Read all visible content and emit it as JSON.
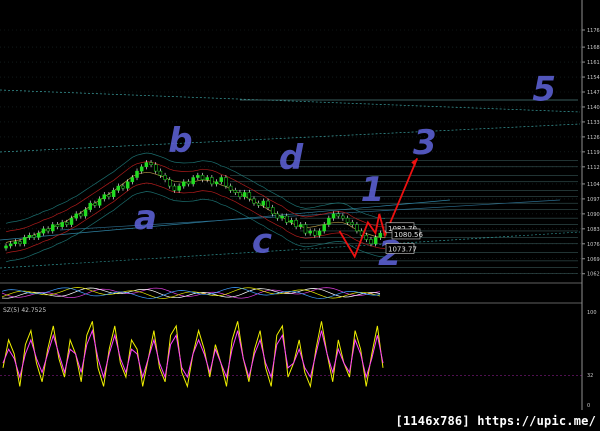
{
  "chart_data": [
    {
      "type": "candlestick",
      "grid": true,
      "ylim": [
        1060,
        1176
      ],
      "price_ticks": [
        "1176",
        "1168",
        "1161",
        "1154",
        "1147",
        "1140",
        "1133",
        "1126",
        "1119",
        "1112",
        "1104",
        "1097",
        "1090",
        "1083",
        "1076",
        "1069",
        "1062"
      ],
      "price_labels": [
        {
          "text": "1082.70",
          "value": 1083.5
        },
        {
          "text": "1080.56",
          "value": 1080.6
        },
        {
          "text": "1073.77",
          "value": 1073.8
        }
      ],
      "close": [
        1075,
        1076,
        1077,
        1076,
        1079,
        1080,
        1079,
        1081,
        1083,
        1082,
        1085,
        1084,
        1086,
        1085,
        1088,
        1090,
        1089,
        1092,
        1095,
        1094,
        1097,
        1099,
        1098,
        1101,
        1103,
        1102,
        1105,
        1107,
        1110,
        1112,
        1114,
        1113,
        1110,
        1108,
        1106,
        1103,
        1101,
        1103,
        1105,
        1104,
        1107,
        1108,
        1106,
        1107,
        1104,
        1105,
        1107,
        1103,
        1101,
        1100,
        1098,
        1100,
        1097,
        1095,
        1094,
        1096,
        1093,
        1090,
        1088,
        1089,
        1086,
        1087,
        1084,
        1085,
        1081,
        1082,
        1080,
        1082,
        1085,
        1088,
        1090,
        1089,
        1088,
        1086,
        1085,
        1082,
        1080,
        1078,
        1076,
        1079,
        1081,
        1080
      ],
      "annotations": [
        {
          "text": "5",
          "x": 0.935,
          "y": 1143
        },
        {
          "text": "b",
          "x": 0.31,
          "y": 1119
        },
        {
          "text": "3",
          "x": 0.73,
          "y": 1118
        },
        {
          "text": "d",
          "x": 0.5,
          "y": 1111
        },
        {
          "text": "1",
          "x": 0.64,
          "y": 1096
        },
        {
          "text": "a",
          "x": 0.25,
          "y": 1083
        },
        {
          "text": "c",
          "x": 0.45,
          "y": 1072
        },
        {
          "text": "2",
          "x": 0.67,
          "y": 1066
        }
      ],
      "arrow_path": [
        [
          1083,
          1082
        ],
        [
          1080,
          1070
        ],
        [
          1076,
          1086
        ],
        [
          1077,
          1081
        ],
        [
          1074,
          1090
        ],
        [
          1075,
          1080
        ],
        [
          1110,
          1116
        ]
      ]
    },
    {
      "type": "line",
      "series": [
        {
          "color": "#e040e0"
        },
        {
          "color": "#ffffff"
        },
        {
          "color": "#e0e000"
        },
        {
          "color": "#40a0ff"
        }
      ]
    },
    {
      "type": "line",
      "title": "SZ(5) 42.7525",
      "ylim": [
        0,
        100
      ],
      "y_ticks": [
        "100",
        "32",
        "0"
      ],
      "levels": [
        32
      ],
      "series": [
        {
          "color": "#f0f000",
          "values": [
            40,
            70,
            55,
            20,
            65,
            80,
            45,
            25,
            60,
            85,
            50,
            30,
            70,
            55,
            25,
            75,
            90,
            40,
            20,
            60,
            85,
            45,
            30,
            70,
            60,
            20,
            50,
            80,
            40,
            25,
            75,
            85,
            35,
            20,
            55,
            80,
            60,
            30,
            65,
            45,
            20,
            70,
            90,
            50,
            25,
            60,
            80,
            40,
            20,
            75,
            85,
            30,
            45,
            70,
            35,
            20,
            60,
            90,
            55,
            25,
            70,
            45,
            30,
            80,
            60,
            20,
            55,
            85,
            40
          ]
        },
        {
          "color": "#ff40ff",
          "values": [
            45,
            60,
            50,
            30,
            55,
            70,
            50,
            35,
            55,
            75,
            55,
            35,
            60,
            55,
            35,
            65,
            80,
            50,
            30,
            55,
            75,
            50,
            35,
            60,
            55,
            30,
            50,
            70,
            45,
            30,
            65,
            75,
            40,
            30,
            55,
            70,
            55,
            35,
            60,
            45,
            30,
            60,
            80,
            50,
            30,
            55,
            70,
            45,
            30,
            65,
            75,
            40,
            45,
            60,
            40,
            30,
            55,
            80,
            55,
            35,
            60,
            45,
            35,
            70,
            55,
            30,
            50,
            75,
            45
          ]
        }
      ]
    }
  ],
  "caption": "[1146x786] https://upic.me/"
}
